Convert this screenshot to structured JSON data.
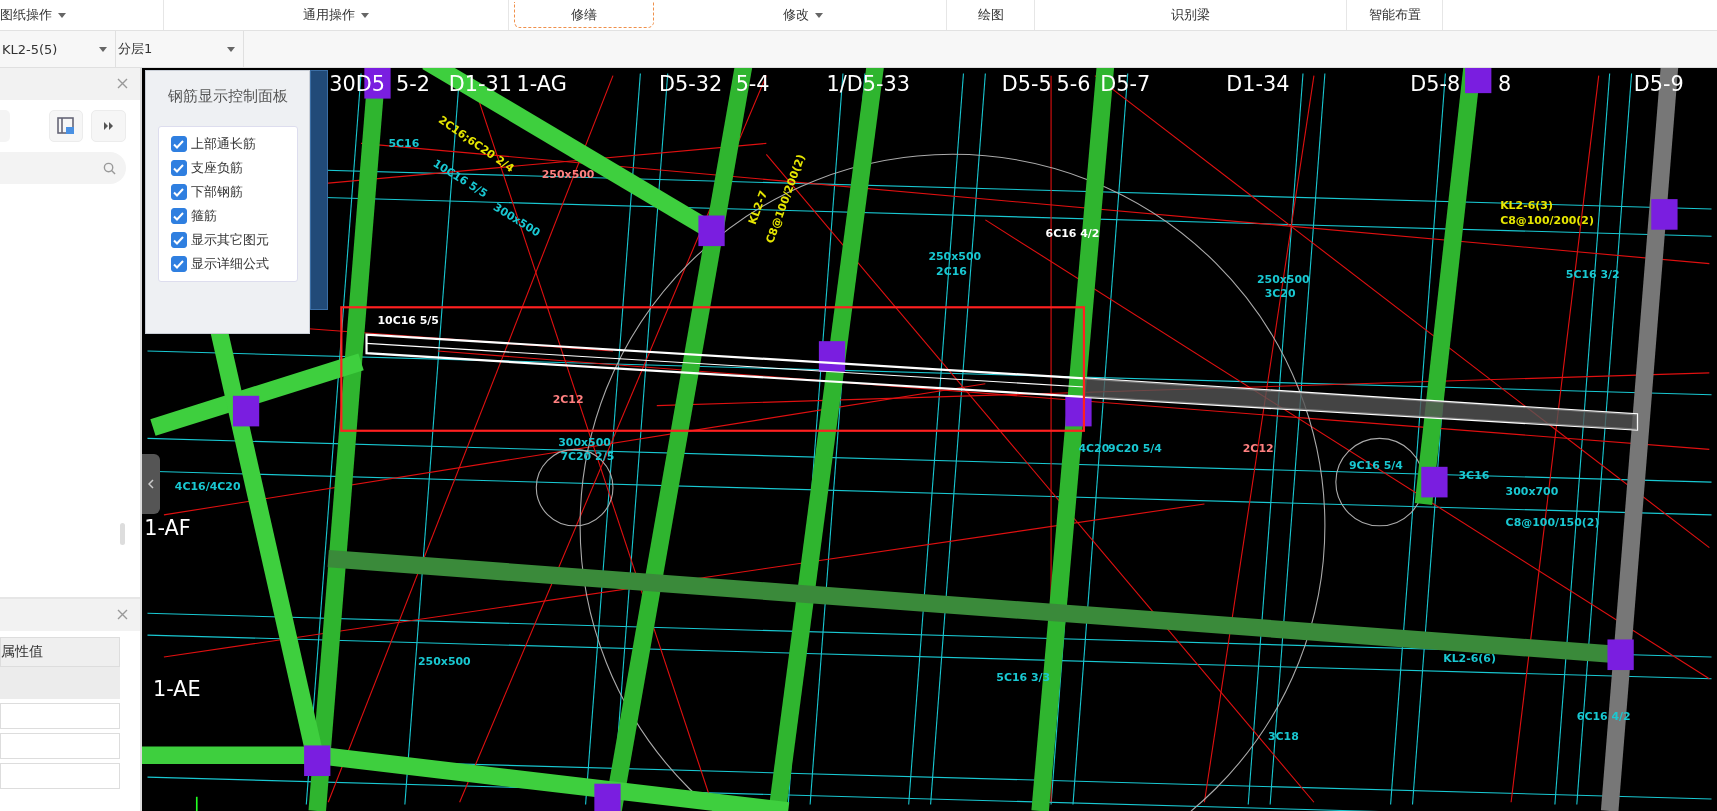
{
  "toolbar": [
    {
      "label": "图纸操作",
      "kind": "dropdown"
    },
    {
      "label": "通用操作",
      "kind": "dropdown"
    },
    {
      "label": "修缮",
      "kind": "highlighted"
    },
    {
      "label": "修改",
      "kind": "dropdown"
    },
    {
      "label": "绘图",
      "kind": "plain"
    },
    {
      "label": "识别梁",
      "kind": "plain"
    },
    {
      "label": "智能布置",
      "kind": "plain"
    }
  ],
  "selectors": [
    {
      "value": "KL2-5(5)"
    },
    {
      "value": "分层1"
    }
  ],
  "property_table": {
    "columns": [
      "属性值"
    ]
  },
  "control_panel": {
    "title": "钢筋显示控制面板",
    "options": [
      {
        "label": "上部通长筋",
        "checked": true
      },
      {
        "label": "支座负筋",
        "checked": true
      },
      {
        "label": "下部钢筋",
        "checked": true
      },
      {
        "label": "箍筋",
        "checked": true
      },
      {
        "label": "显示其它图元",
        "checked": true
      },
      {
        "label": "显示详细公式",
        "checked": true
      }
    ]
  },
  "canvas": {
    "axis_labels": [
      "30D5",
      "5-2",
      "D1-31",
      "1-AG",
      "D5-32",
      "5-4",
      "1/D5-33",
      "D5-5",
      "5-6",
      "D5-7",
      "D1-34",
      "D5-8",
      "8",
      "D5-9",
      "1-AF",
      "1-AE"
    ],
    "annotations": [
      {
        "text": "5C16",
        "color": "#19c8d2"
      },
      {
        "text": "10C16 5/5",
        "color": "#19c8d2"
      },
      {
        "text": "2C16;6C20 2/4",
        "color": "#e6e600"
      },
      {
        "text": "250x500",
        "color": "#ff8080"
      },
      {
        "text": "300x500",
        "color": "#19c8d2"
      },
      {
        "text": "KL2-7",
        "color": "#e6e600"
      },
      {
        "text": "C8@100/200(2)",
        "color": "#e6e600"
      },
      {
        "text": "250x500",
        "color": "#19c8d2"
      },
      {
        "text": "2C16",
        "color": "#19c8d2"
      },
      {
        "text": "6C16 4/2",
        "color": "#ffffff"
      },
      {
        "text": "250x500",
        "color": "#19c8d2"
      },
      {
        "text": "3C20",
        "color": "#19c8d2"
      },
      {
        "text": "KL2-6(3)",
        "color": "#e6e600"
      },
      {
        "text": "C8@100/200(2)",
        "color": "#e6e600"
      },
      {
        "text": "5C16 3/2",
        "color": "#19c8d2"
      },
      {
        "text": "300x500",
        "color": "#19c8d2"
      },
      {
        "text": "7C20 2/5",
        "color": "#19c8d2"
      },
      {
        "text": "4C20",
        "color": "#19c8d2"
      },
      {
        "text": "9C20 5/4",
        "color": "#19c8d2"
      },
      {
        "text": "2C12",
        "color": "#ff8080"
      },
      {
        "text": "300x700",
        "color": "#19c8d2"
      },
      {
        "text": "C8@100/150(2)",
        "color": "#19c8d2"
      },
      {
        "text": "3C16",
        "color": "#19c8d2"
      },
      {
        "text": "250x500",
        "color": "#19c8d2"
      },
      {
        "text": "KL2-6(6)",
        "color": "#19c8d2"
      },
      {
        "text": "6C16 4/2",
        "color": "#19c8d2"
      },
      {
        "text": "3C18",
        "color": "#19c8d2"
      },
      {
        "text": "5C16 3/3",
        "color": "#19c8d2"
      },
      {
        "text": "10C16 5/5",
        "color": "#ffffff"
      },
      {
        "text": "2C12",
        "color": "#ff8080"
      },
      {
        "text": "4C16/4C20",
        "color": "#19c8d2"
      },
      {
        "text": "9C16 5/4",
        "color": "#19c8d2"
      }
    ]
  }
}
